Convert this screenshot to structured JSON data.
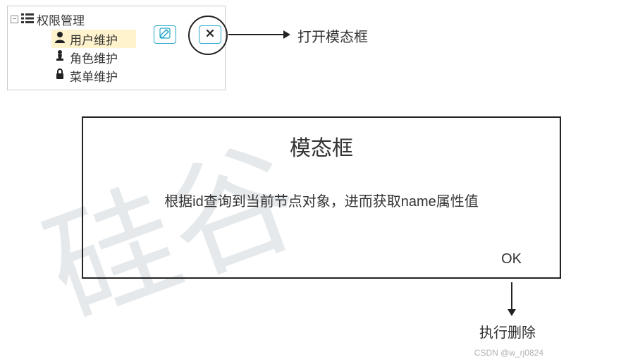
{
  "watermark": "硅谷",
  "credit": "CSDN @w_rj0824",
  "tree": {
    "root_label": "权限管理",
    "items": [
      {
        "label": "用户维护",
        "icon": "person-icon",
        "selected": true
      },
      {
        "label": "角色维护",
        "icon": "pawn-icon",
        "selected": false
      },
      {
        "label": "菜单维护",
        "icon": "lock-icon",
        "selected": false
      }
    ]
  },
  "buttons": {
    "edit_title": "编辑",
    "delete_title": "删除"
  },
  "annotations": {
    "open_modal": "打开模态框",
    "execute_delete": "执行删除"
  },
  "modal": {
    "title": "模态框",
    "body": "根据id查询到当前节点对象，进而获取name属性值",
    "ok": "OK"
  }
}
